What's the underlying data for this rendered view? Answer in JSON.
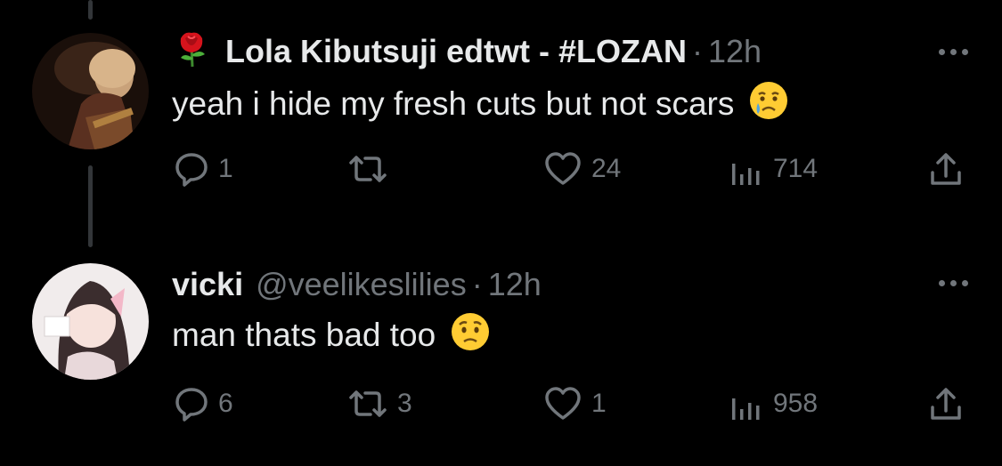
{
  "tweets": [
    {
      "name": "Lola Kibutsuji edtwt - #LOZAN",
      "name_icon": "rose-emoji",
      "handle": "",
      "time": "12h",
      "text": "yeah i hide my fresh cuts but not scars",
      "emoji": "crying-face-emoji",
      "replies": "1",
      "retweets": "",
      "likes": "24",
      "views": "714"
    },
    {
      "name": "vicki",
      "handle": "@veelikeslilies",
      "time": "12h",
      "text": "man thats bad too",
      "emoji": "worried-face-emoji",
      "replies": "6",
      "retweets": "3",
      "likes": "1",
      "views": "958"
    }
  ],
  "separator": "·",
  "colors": {
    "background": "#000000",
    "text": "#e7e9ea",
    "muted": "#71767b",
    "thread_line": "#333639"
  }
}
